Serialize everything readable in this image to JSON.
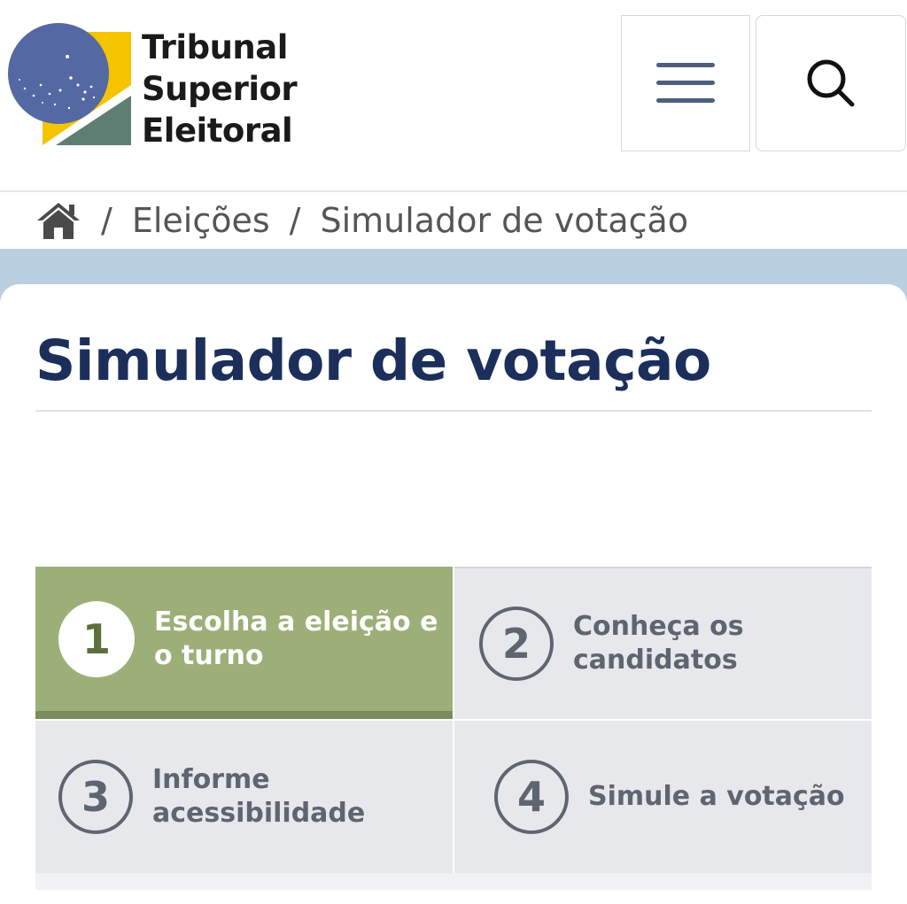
{
  "header": {
    "logo_lines": [
      "Tribunal",
      "Superior",
      "Eleitoral"
    ],
    "menu_icon": "hamburger-menu-icon",
    "search_icon": "search-icon"
  },
  "breadcrumb": {
    "home_icon": "home-icon",
    "separator": "/",
    "items": [
      "Eleições",
      "Simulador de votação"
    ]
  },
  "main": {
    "title": "Simulador de votação"
  },
  "steps": [
    {
      "number": "1",
      "label_lines": [
        "Escolha a eleição e",
        "o turno"
      ],
      "active": true
    },
    {
      "number": "2",
      "label_lines": [
        "Conheça os",
        "candidatos"
      ],
      "active": false
    },
    {
      "number": "3",
      "label_lines": [
        "Informe",
        "acessibilidade"
      ],
      "active": false
    },
    {
      "number": "4",
      "label_lines": [
        "Simule a votação"
      ],
      "active": false
    }
  ],
  "colors": {
    "title": "#1b2f5a",
    "active_step": "#9caf78",
    "inactive_step": "#e6e8ec",
    "band": "#b9cfe0"
  }
}
